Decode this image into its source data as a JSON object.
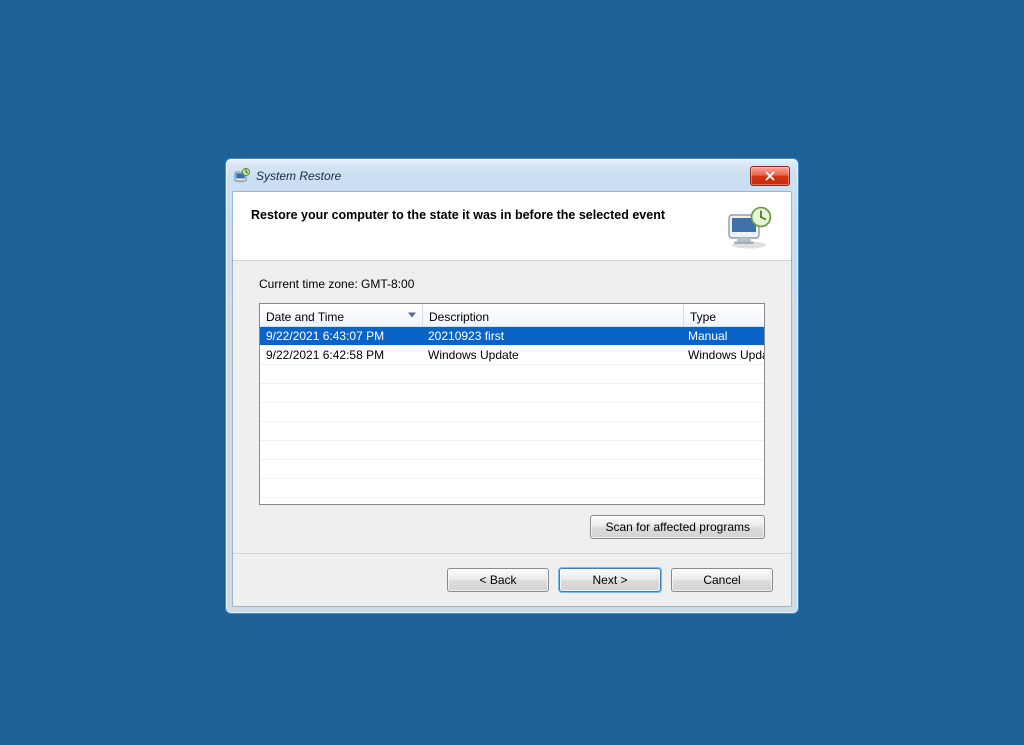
{
  "window": {
    "title": "System Restore",
    "close_label": "Close"
  },
  "banner": {
    "heading": "Restore your computer to the state it was in before the selected event"
  },
  "content": {
    "timezone_label": "Current time zone: GMT-8:00",
    "columns": {
      "datetime": "Date and Time",
      "description": "Description",
      "type": "Type"
    },
    "rows": [
      {
        "datetime": "9/22/2021 6:43:07 PM",
        "description": "20210923 first",
        "type": "Manual",
        "selected": true
      },
      {
        "datetime": "9/22/2021 6:42:58 PM",
        "description": "Windows Update",
        "type": "Windows Update",
        "selected": false
      }
    ],
    "scan_button": "Scan for affected programs"
  },
  "footer": {
    "back": "< Back",
    "next": "Next >",
    "cancel": "Cancel"
  }
}
